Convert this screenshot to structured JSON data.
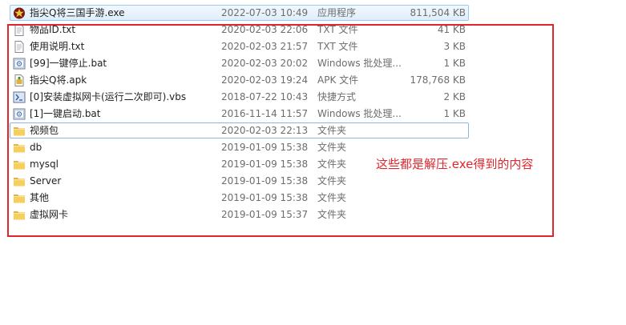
{
  "files": [
    {
      "name": "指尖Q将三国手游.exe",
      "date": "2022-07-03 10:49",
      "type": "应用程序",
      "size": "811,504 KB",
      "icon": "exe-star-icon",
      "state": "selected"
    },
    {
      "name": "物品ID.txt",
      "date": "2020-02-03 22:06",
      "type": "TXT 文件",
      "size": "41 KB",
      "icon": "text-file-icon",
      "state": ""
    },
    {
      "name": "使用说明.txt",
      "date": "2020-02-03 21:57",
      "type": "TXT 文件",
      "size": "3 KB",
      "icon": "text-file-icon",
      "state": ""
    },
    {
      "name": "[99]一键停止.bat",
      "date": "2020-02-03 20:02",
      "type": "Windows 批处理...",
      "size": "1 KB",
      "icon": "batch-file-icon",
      "state": ""
    },
    {
      "name": "指尖Q将.apk",
      "date": "2020-02-03 19:24",
      "type": "APK 文件",
      "size": "178,768 KB",
      "icon": "apk-file-icon",
      "state": ""
    },
    {
      "name": "[0]安装虚拟网卡(运行二次即可).vbs",
      "date": "2018-07-22 10:43",
      "type": "快捷方式",
      "size": "2 KB",
      "icon": "script-file-icon",
      "state": ""
    },
    {
      "name": "[1]一键启动.bat",
      "date": "2016-11-14 11:57",
      "type": "Windows 批处理...",
      "size": "1 KB",
      "icon": "batch-file-icon",
      "state": ""
    },
    {
      "name": "视频包",
      "date": "2020-02-03 22:13",
      "type": "文件夹",
      "size": "",
      "icon": "folder-icon",
      "state": "focused"
    },
    {
      "name": "db",
      "date": "2019-01-09 15:38",
      "type": "文件夹",
      "size": "",
      "icon": "folder-icon",
      "state": ""
    },
    {
      "name": "mysql",
      "date": "2019-01-09 15:38",
      "type": "文件夹",
      "size": "",
      "icon": "folder-icon",
      "state": ""
    },
    {
      "name": "Server",
      "date": "2019-01-09 15:38",
      "type": "文件夹",
      "size": "",
      "icon": "folder-icon",
      "state": ""
    },
    {
      "name": "其他",
      "date": "2019-01-09 15:38",
      "type": "文件夹",
      "size": "",
      "icon": "folder-icon",
      "state": ""
    },
    {
      "name": "虚拟网卡",
      "date": "2019-01-09 15:37",
      "type": "文件夹",
      "size": "",
      "icon": "folder-icon",
      "state": ""
    }
  ],
  "annotation": {
    "text": "这些都是解压.exe得到的内容",
    "color": "#e0262d"
  },
  "colors": {
    "selection_bg": "#dfeefc",
    "selection_border": "#99c9ef",
    "meta_text": "#6d6d6d",
    "folder": "#e9b840"
  }
}
